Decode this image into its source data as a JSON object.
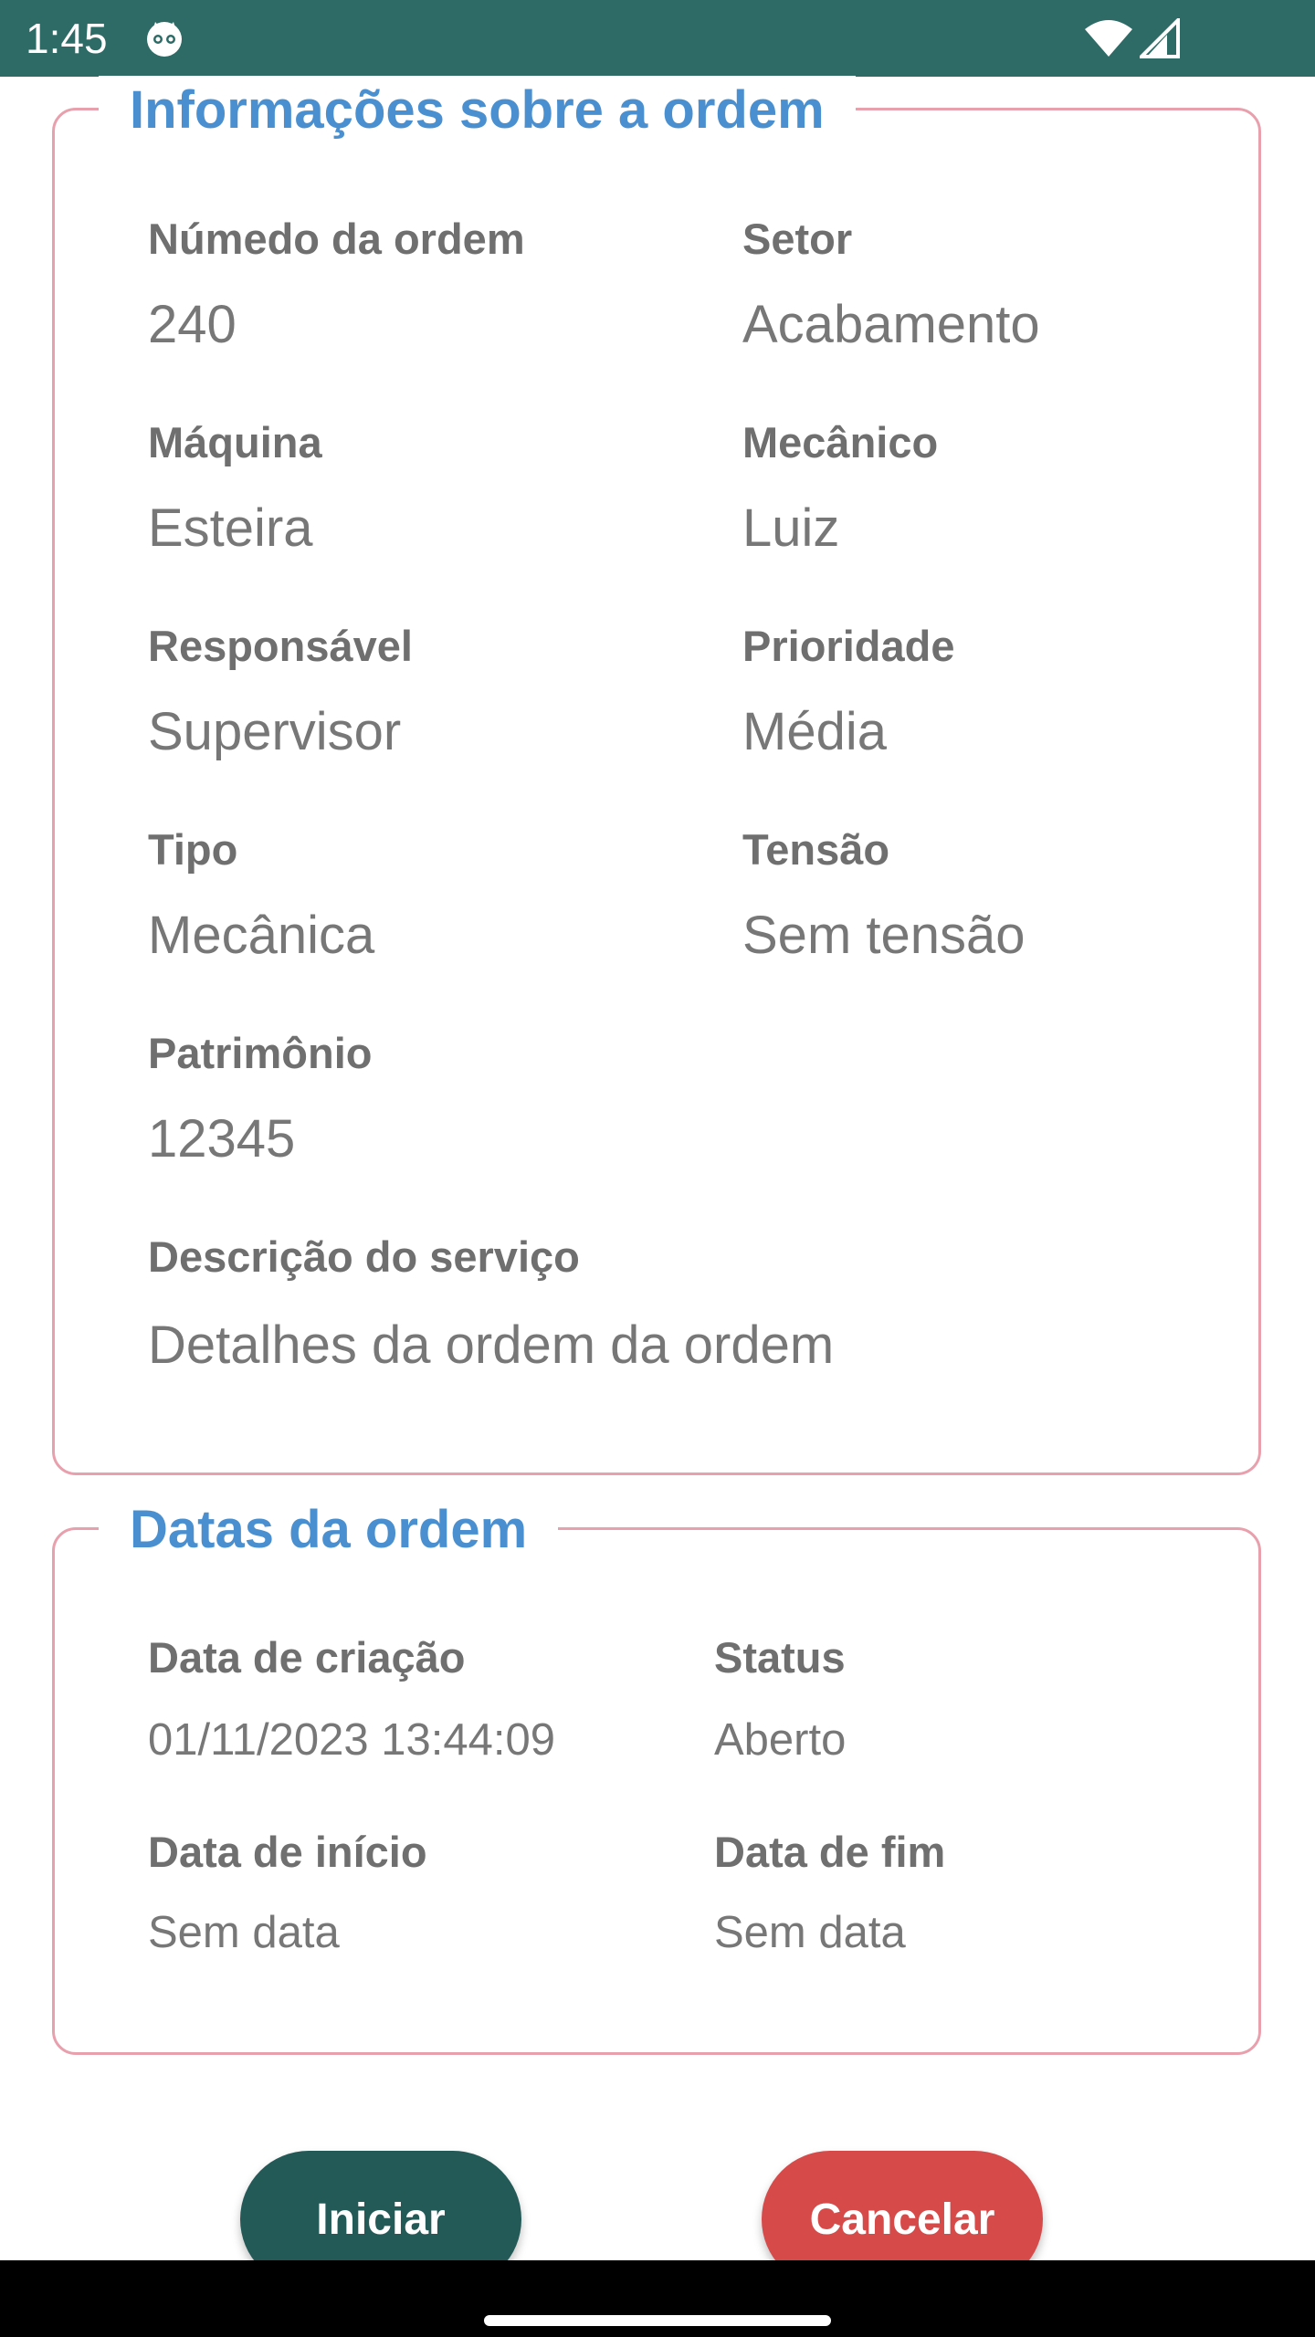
{
  "status_bar": {
    "time": "1:45"
  },
  "info_card": {
    "title": "Informações sobre a ordem",
    "fields": [
      {
        "label": "Númedo da ordem",
        "value": "240"
      },
      {
        "label": "Setor",
        "value": "Acabamento"
      },
      {
        "label": "Máquina",
        "value": "Esteira"
      },
      {
        "label": "Mecânico",
        "value": "Luiz"
      },
      {
        "label": "Responsável",
        "value": "Supervisor"
      },
      {
        "label": "Prioridade",
        "value": "Média"
      },
      {
        "label": "Tipo",
        "value": "Mecânica"
      },
      {
        "label": "Tensão",
        "value": "Sem tensão"
      },
      {
        "label": "Patrimônio",
        "value": "12345"
      },
      {
        "label": "Descrição do serviço",
        "value": "Detalhes da ordem da ordem"
      }
    ]
  },
  "dates_card": {
    "title": "Datas da ordem",
    "fields": [
      {
        "label": "Data de criação",
        "value": "01/11/2023 13:44:09"
      },
      {
        "label": "Status",
        "value": "Aberto"
      },
      {
        "label": "Data de início",
        "value": "Sem data"
      },
      {
        "label": "Data de fim",
        "value": "Sem data"
      }
    ]
  },
  "actions": {
    "start_label": "Iniciar",
    "cancel_label": "Cancelar"
  },
  "colors": {
    "status_bar": "#2e6b66",
    "card_border": "#e8a0ad",
    "card_title": "#4a90d0",
    "start_button": "#235a58",
    "cancel_button": "#d64a4a"
  }
}
